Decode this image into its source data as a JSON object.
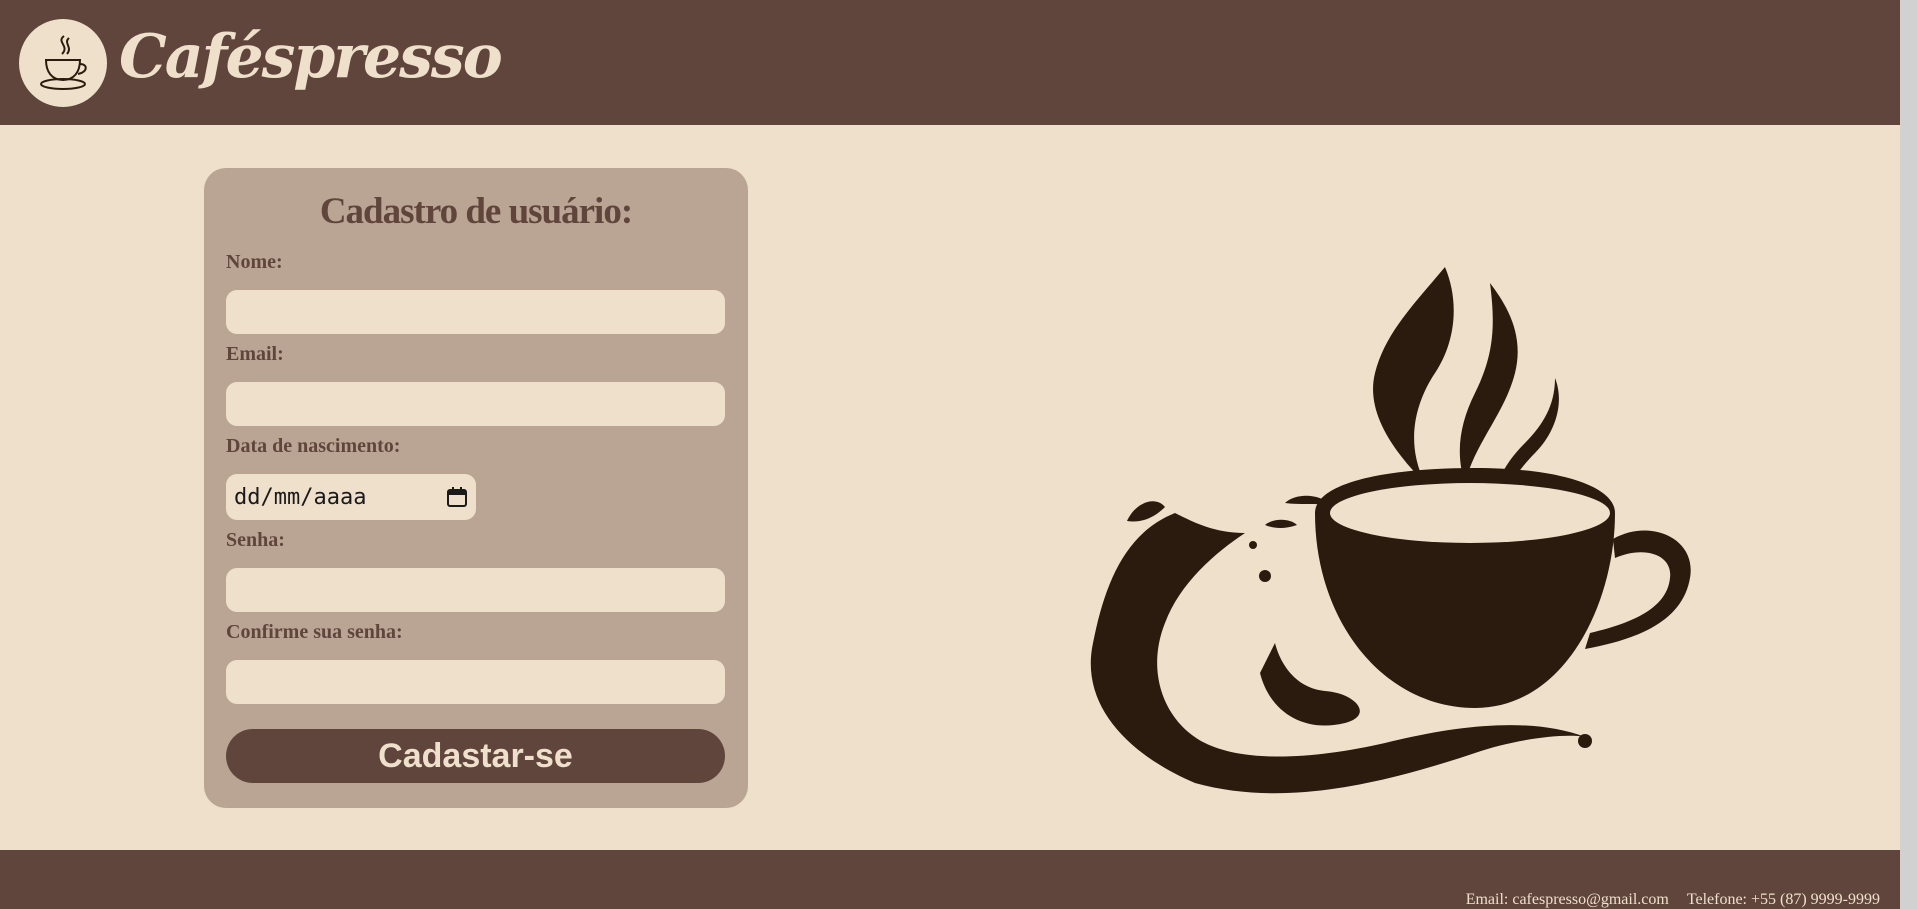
{
  "header": {
    "brand": "Caféspresso",
    "logo_icon": "coffee-cup-icon"
  },
  "form": {
    "title": "Cadastro de usuário:",
    "fields": [
      {
        "label": "Nome:",
        "value": ""
      },
      {
        "label": "Email:",
        "value": ""
      },
      {
        "label": "Data de nascimento:",
        "value": "dd/mm/aaaa"
      },
      {
        "label": "Senha:",
        "value": ""
      },
      {
        "label": "Confirme sua senha:",
        "value": ""
      }
    ],
    "submit_label": "Cadastar-se",
    "calendar_icon": "calendar-icon"
  },
  "hero": {
    "icon": "coffee-splash-icon"
  },
  "footer": {
    "email": "Email: cafespresso@gmail.com",
    "phone": "Telefone: +55 (87) 9999-9999"
  },
  "colors": {
    "header": "#5f453b",
    "background": "#efe0cb",
    "card": "#baa595",
    "dark_coffee": "#2b1b0e"
  }
}
